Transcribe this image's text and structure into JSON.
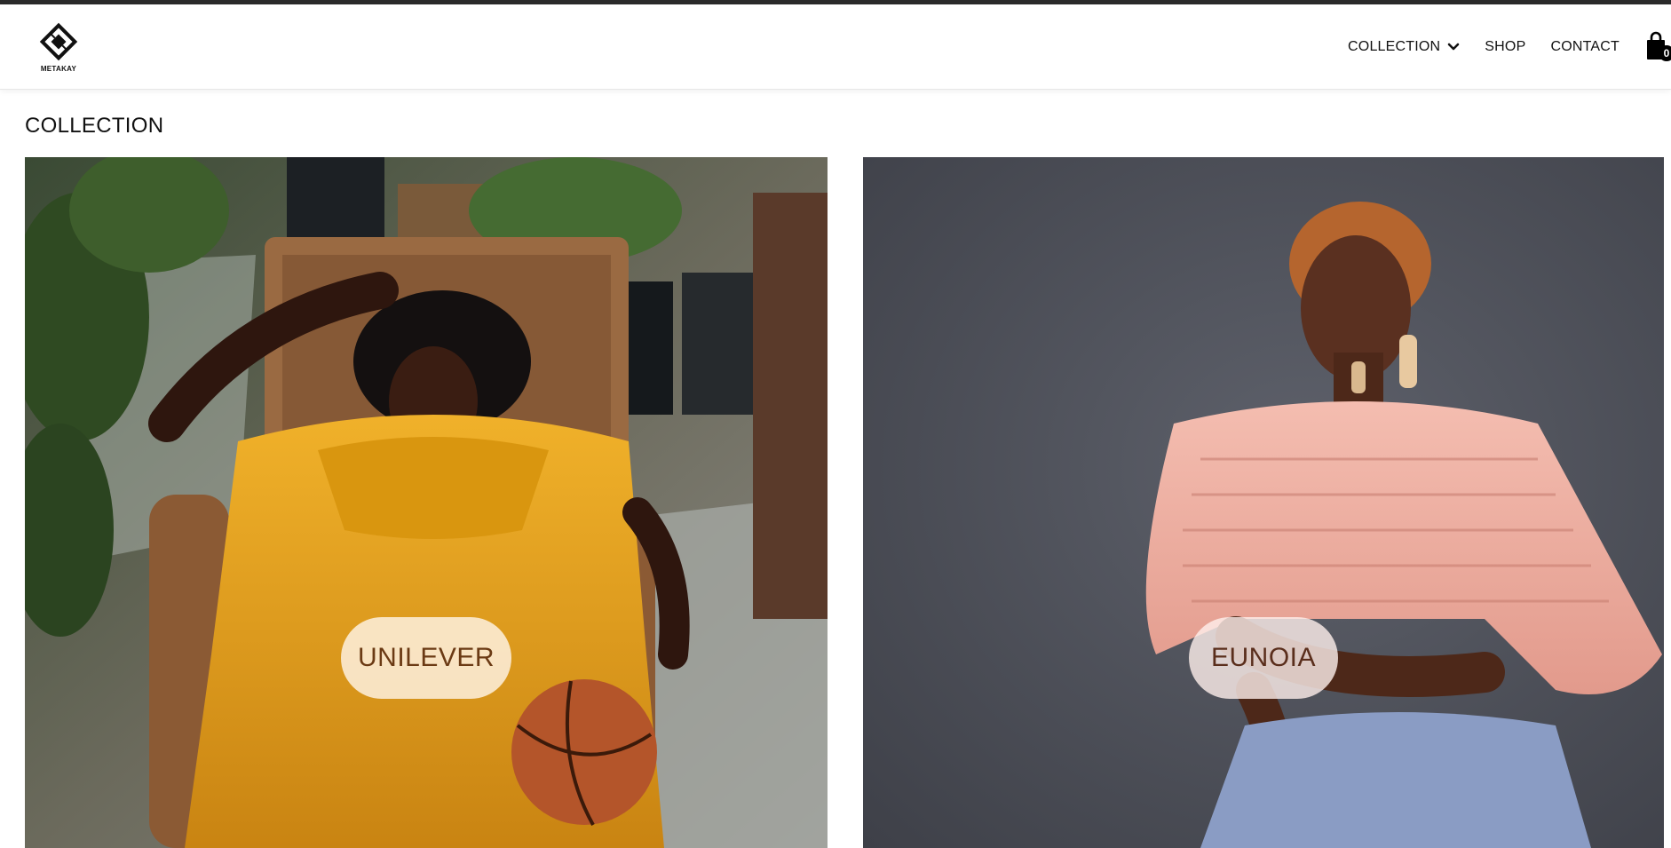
{
  "header": {
    "brand": "METAKAY",
    "nav": {
      "collection": "COLLECTION",
      "shop": "SHOP",
      "contact": "CONTACT"
    },
    "cart_count": "0"
  },
  "page": {
    "title": "COLLECTION"
  },
  "collections": [
    {
      "label": "UNILEVER"
    },
    {
      "label": "EUNOIA"
    }
  ],
  "icons": {
    "logo": "diamond-logo-icon",
    "dropdown": "chevron-down-icon",
    "cart": "shopping-bag-icon"
  },
  "colors": {
    "top_strip": "#2a2a2a",
    "text": "#111111",
    "pill_bg": "#fff4e6",
    "pill_text": "#6b3a14",
    "eunoia_bg": "#52545e",
    "unilever_dress": "#e8a21d"
  }
}
